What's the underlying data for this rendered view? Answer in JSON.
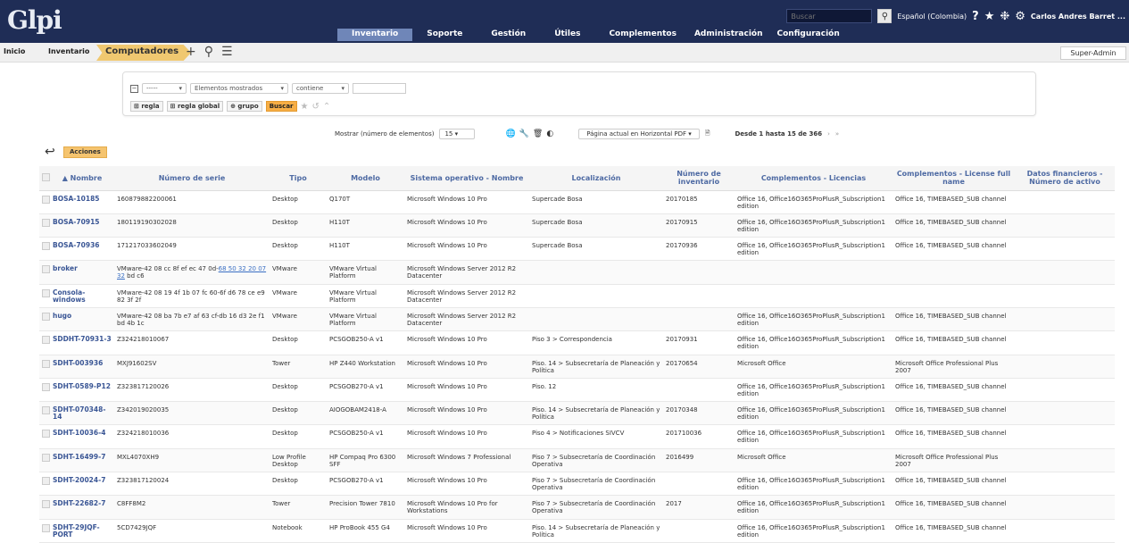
{
  "header": {
    "logo": "Glpi",
    "search_placeholder": "Buscar",
    "language": "Español (Colombia)",
    "user": "Carlos Andres Barret ...",
    "nav": [
      "Inventario",
      "Soporte",
      "Gestión",
      "Útiles",
      "Complementos",
      "Administración",
      "Configuración"
    ],
    "active_nav": "Inventario"
  },
  "breadcrumb": {
    "home": "Inicio",
    "section": "Inventario",
    "current": "Computadores",
    "profile": "Super-Admin"
  },
  "search": {
    "field_placeholder": "-----",
    "display_option": "Elementos mostrados",
    "operator": "contiene",
    "btn_rule": "regla",
    "btn_global_rule": "regla global",
    "btn_group": "grupo",
    "btn_search": "Buscar"
  },
  "pager": {
    "show_label": "Mostrar (número de elementos)",
    "per_page": "15",
    "export_option": "Página actual en Horizontal PDF",
    "range": "Desde 1 hasta 15 de 366"
  },
  "actions_label": "Acciones",
  "table": {
    "headers": [
      "▲ Nombre",
      "Número de serie",
      "Tipo",
      "Modelo",
      "Sistema operativo - Nombre",
      "Localización",
      "Número de inventario",
      "Complementos - Licencias",
      "Complementos - License full name",
      "Datos financieros - Número de activo"
    ],
    "rows": [
      {
        "name": "BOSA-10185",
        "serial": "160879882200061",
        "serial_link": "",
        "serial_tail": "",
        "type": "Desktop",
        "model": "Q170T",
        "os": "Microsoft Windows 10 Pro",
        "location": "Supercade Bosa",
        "inventory": "20170185",
        "licenses": "Office 16, Office16O365ProPlusR_Subscription1 edition",
        "license_full": "Office 16, TIMEBASED_SUB channel",
        "asset": ""
      },
      {
        "name": "BOSA-70915",
        "serial": "180119190302028",
        "serial_link": "",
        "serial_tail": "",
        "type": "Desktop",
        "model": "H110T",
        "os": "Microsoft Windows 10 Pro",
        "location": "Supercade Bosa",
        "inventory": "20170915",
        "licenses": "Office 16, Office16O365ProPlusR_Subscription1 edition",
        "license_full": "Office 16, TIMEBASED_SUB channel",
        "asset": ""
      },
      {
        "name": "BOSA-70936",
        "serial": "171217033602049",
        "serial_link": "",
        "serial_tail": "",
        "type": "Desktop",
        "model": "H110T",
        "os": "Microsoft Windows 10 Pro",
        "location": "Supercade Bosa",
        "inventory": "20170936",
        "licenses": "Office 16, Office16O365ProPlusR_Subscription1 edition",
        "license_full": "Office 16, TIMEBASED_SUB channel",
        "asset": ""
      },
      {
        "name": "broker",
        "serial": "VMware-42 08 cc 8f ef ec 47 0d-",
        "serial_link": "68 50 32 20 07 32",
        "serial_tail": " bd c6",
        "type": "VMware",
        "model": "VMware Virtual Platform",
        "os": "Microsoft Windows Server 2012 R2 Datacenter",
        "location": "",
        "inventory": "",
        "licenses": "",
        "license_full": "",
        "asset": ""
      },
      {
        "name": "Consola-windows",
        "serial": "VMware-42 08 19 4f 1b 07 fc 60-6f d6 78 ce e9 82 3f 2f",
        "serial_link": "",
        "serial_tail": "",
        "type": "VMware",
        "model": "VMware Virtual Platform",
        "os": "Microsoft Windows Server 2012 R2 Datacenter",
        "location": "",
        "inventory": "",
        "licenses": "",
        "license_full": "",
        "asset": ""
      },
      {
        "name": "hugo",
        "serial": "VMware-42 08 ba 7b e7 af 63 cf-db 16 d3 2e f1 bd 4b 1c",
        "serial_link": "",
        "serial_tail": "",
        "type": "VMware",
        "model": "VMware Virtual Platform",
        "os": "Microsoft Windows Server 2012 R2 Datacenter",
        "location": "",
        "inventory": "",
        "licenses": "Office 16, Office16O365ProPlusR_Subscription1 edition",
        "license_full": "Office 16, TIMEBASED_SUB channel",
        "asset": ""
      },
      {
        "name": "SDDHT-70931-3",
        "serial": "Z324218010067",
        "serial_link": "",
        "serial_tail": "",
        "type": "Desktop",
        "model": "PCSGOB250-A v1",
        "os": "Microsoft Windows 10 Pro",
        "location": "Piso 3 > Correspondencia",
        "inventory": "20170931",
        "licenses": "Office 16, Office16O365ProPlusR_Subscription1 edition",
        "license_full": "Office 16, TIMEBASED_SUB channel",
        "asset": ""
      },
      {
        "name": "SDHT-003936",
        "serial": "MXJ91602SV",
        "serial_link": "",
        "serial_tail": "",
        "type": "Tower",
        "model": "HP Z440 Workstation",
        "os": "Microsoft Windows 10 Pro",
        "location": "Piso. 14 > Subsecretaría de Planeación y Política",
        "inventory": "20170654",
        "licenses": "Microsoft Office",
        "license_full": "Microsoft Office Professional Plus 2007",
        "asset": ""
      },
      {
        "name": "SDHT-0589-P12",
        "serial": "Z323817120026",
        "serial_link": "",
        "serial_tail": "",
        "type": "Desktop",
        "model": "PCSGOB270-A v1",
        "os": "Microsoft Windows 10 Pro",
        "location": "Piso. 12",
        "inventory": "",
        "licenses": "Office 16, Office16O365ProPlusR_Subscription1 edition",
        "license_full": "Office 16, TIMEBASED_SUB channel",
        "asset": ""
      },
      {
        "name": "SDHT-070348-14",
        "serial": "Z342019020035",
        "serial_link": "",
        "serial_tail": "",
        "type": "Desktop",
        "model": "AIOGOBAM2418-A",
        "os": "Microsoft Windows 10 Pro",
        "location": "Piso. 14 > Subsecretaría de Planeación y Política",
        "inventory": "20170348",
        "licenses": "Office 16, Office16O365ProPlusR_Subscription1 edition",
        "license_full": "Office 16, TIMEBASED_SUB channel",
        "asset": ""
      },
      {
        "name": "SDHT-10036-4",
        "serial": "Z324218010036",
        "serial_link": "",
        "serial_tail": "",
        "type": "Desktop",
        "model": "PCSGOB250-A v1",
        "os": "Microsoft Windows 10 Pro",
        "location": "Piso 4 > Notificaciones SIVCV",
        "inventory": "201710036",
        "licenses": "Office 16, Office16O365ProPlusR_Subscription1 edition",
        "license_full": "Office 16, TIMEBASED_SUB channel",
        "asset": ""
      },
      {
        "name": "SDHT-16499-7",
        "serial": "MXL4070XH9",
        "serial_link": "",
        "serial_tail": "",
        "type": "Low Profile Desktop",
        "model": "HP Compaq Pro 6300 SFF",
        "os": "Microsoft Windows 7 Professional",
        "location": "Piso 7 > Subsecretaría de Coordinación Operativa",
        "inventory": "2016499",
        "licenses": "Microsoft Office",
        "license_full": "Microsoft Office Professional Plus 2007",
        "asset": ""
      },
      {
        "name": "SDHT-20024-7",
        "serial": "Z323817120024",
        "serial_link": "",
        "serial_tail": "",
        "type": "Desktop",
        "model": "PCSGOB270-A v1",
        "os": "Microsoft Windows 10 Pro",
        "location": "Piso 7 > Subsecretaría de Coordinación Operativa",
        "inventory": "",
        "licenses": "Office 16, Office16O365ProPlusR_Subscription1 edition",
        "license_full": "Office 16, TIMEBASED_SUB channel",
        "asset": ""
      },
      {
        "name": "SDHT-22682-7",
        "serial": "C8FF8M2",
        "serial_link": "",
        "serial_tail": "",
        "type": "Tower",
        "model": "Precision Tower 7810",
        "os": "Microsoft Windows 10 Pro for Workstations",
        "location": "Piso 7 > Subsecretaría de Coordinación Operativa",
        "inventory": "2017",
        "licenses": "Office 16, Office16O365ProPlusR_Subscription1 edition",
        "license_full": "Office 16, TIMEBASED_SUB channel",
        "asset": ""
      },
      {
        "name": "SDHT-29JQF-PORT",
        "serial": "5CD7429JQF",
        "serial_link": "",
        "serial_tail": "",
        "type": "Notebook",
        "model": "HP ProBook 455 G4",
        "os": "Microsoft Windows 10 Pro",
        "location": "Piso. 14 > Subsecretaría de Planeación y Política",
        "inventory": "",
        "licenses": "Office 16, Office16O365ProPlusR_Subscription1 edition",
        "license_full": "Office 16, TIMEBASED_SUB channel",
        "asset": ""
      }
    ]
  }
}
